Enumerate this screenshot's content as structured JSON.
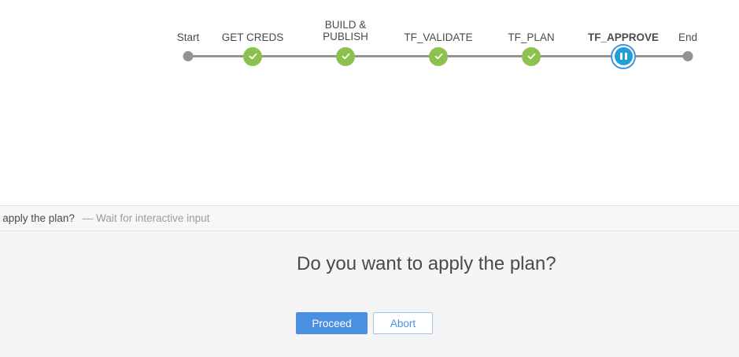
{
  "pipeline": {
    "start_label": "Start",
    "end_label": "End",
    "stages": [
      {
        "line1": "GET CREDS",
        "line2": "",
        "status": "success"
      },
      {
        "line1": "BUILD &",
        "line2": "PUBLISH",
        "status": "success"
      },
      {
        "line1": "TF_VALIDATE",
        "line2": "",
        "status": "success"
      },
      {
        "line1": "TF_PLAN",
        "line2": "",
        "status": "success"
      },
      {
        "line1": "TF_APPROVE",
        "line2": "",
        "status": "paused"
      }
    ]
  },
  "step": {
    "title": "o apply the plan?",
    "subtitle": "— Wait for interactive input"
  },
  "input": {
    "question": "Do you want to apply the plan?",
    "proceed_label": "Proceed",
    "abort_label": "Abort"
  },
  "colors": {
    "success": "#8cc04f",
    "paused": "#1d9fd8",
    "primary": "#4a90e2"
  }
}
